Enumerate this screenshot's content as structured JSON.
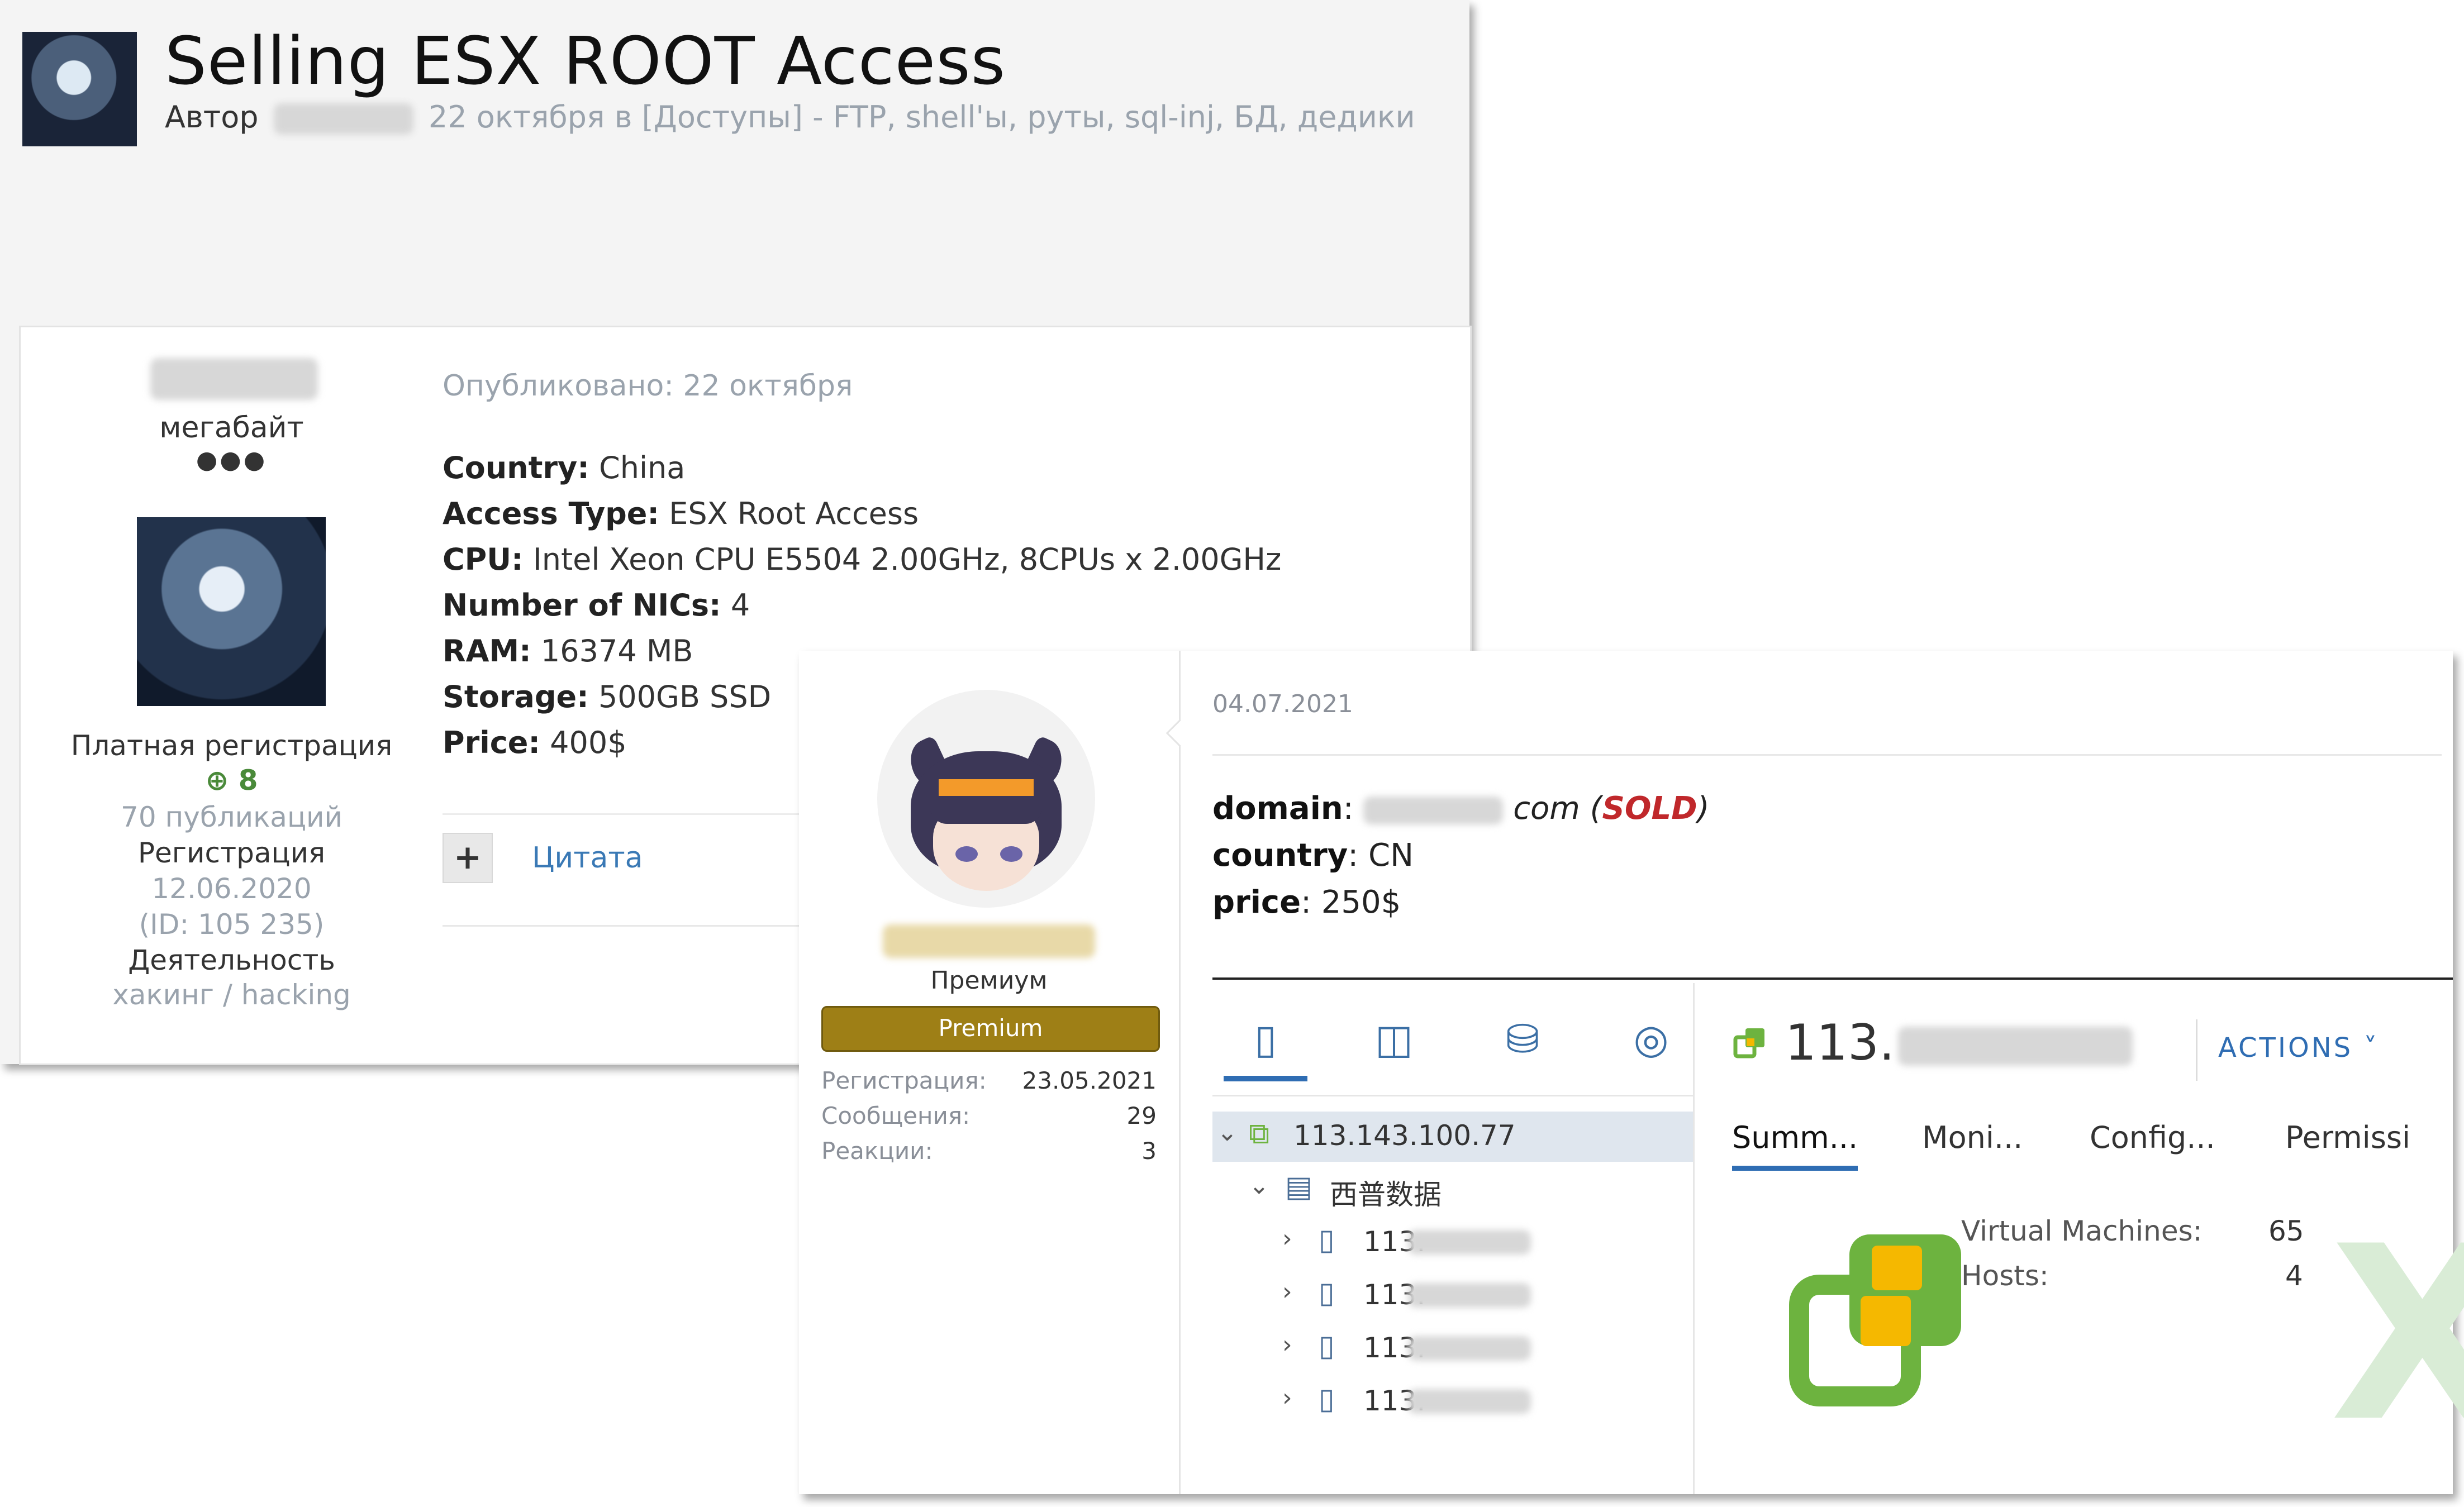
{
  "forum_post": {
    "title": "Selling ESX ROOT Access",
    "author_label": "Автор",
    "author_name": "",
    "meta_date_category": "22 октября в [Доступы] - FTP, shell'ы, руты, sql-inj, БД, дедики",
    "user": {
      "rank": "мегабайт",
      "rank_dots": "●●●",
      "registration_type": "Платная регистрация",
      "reputation": "8",
      "publications": "70 публикаций",
      "registration_label": "Регистрация",
      "registration_date": "12.06.2020",
      "id_text": "(ID: 105 235)",
      "activity_label": "Деятельность",
      "activity_value": "хакинг / hacking"
    },
    "published": "Опубликовано: 22 октября",
    "details": [
      {
        "label": "Country:",
        "value": "China"
      },
      {
        "label": "Access Type:",
        "value": "ESX Root Access"
      },
      {
        "label": "CPU:",
        "value": "Intel Xeon CPU E5504 2.00GHz, 8CPUs x 2.00GHz"
      },
      {
        "label": "Number of NICs:",
        "value": "4"
      },
      {
        "label": "RAM:",
        "value": "16374 MB"
      },
      {
        "label": "Storage:",
        "value": "500GB SSD"
      },
      {
        "label": "Price:",
        "value": "400$"
      }
    ],
    "plus_button": "+",
    "quote_label": "Цитата"
  },
  "listing": {
    "role": "Премиум",
    "badge": "Premium",
    "stats": [
      {
        "label": "Регистрация:",
        "value": "23.05.2021"
      },
      {
        "label": "Сообщения:",
        "value": "29"
      },
      {
        "label": "Реакции:",
        "value": "3"
      }
    ],
    "date": "04.07.2021",
    "domain_label": "domain",
    "domain_suffix": "com",
    "sold": "SOLD",
    "country_label": "country",
    "country_value": "CN",
    "price_label": "price",
    "price_value": "250$"
  },
  "vsphere": {
    "nav_tabs": [
      "hosts-and-clusters-icon",
      "vms-and-templates-icon",
      "storage-icon",
      "networking-icon"
    ],
    "tree": {
      "root": "113.143.100.77",
      "datacenter": "西普数据",
      "hosts": [
        "113.",
        "113.",
        "113.",
        "113."
      ]
    },
    "header_title": "113.",
    "actions_label": "ACTIONS ˅",
    "tabs": [
      "Summ...",
      "Moni...",
      "Config...",
      "Permissi"
    ],
    "summary": {
      "vm_label": "Virtual Machines:",
      "vm_value": "65",
      "hosts_label": "Hosts:",
      "hosts_value": "4"
    },
    "colors": {
      "accent": "#2f6db3",
      "vcenter_green": "#6db33f",
      "vcenter_yellow": "#f5b800"
    }
  }
}
